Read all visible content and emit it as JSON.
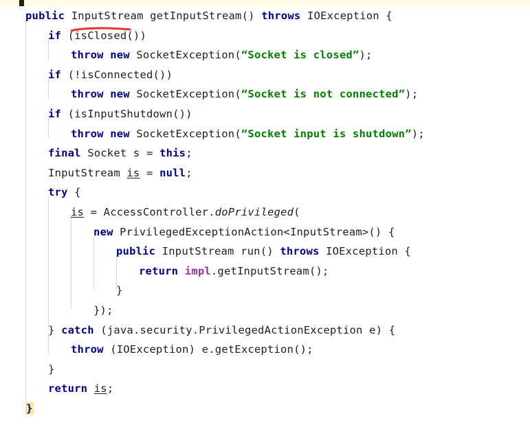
{
  "window": {
    "kind": "code-viewer",
    "background": "#ffffff",
    "top_band_color": "#fffbe6"
  },
  "theme": {
    "keyword": "#00008f",
    "string": "#008000",
    "field": "#9b30a0",
    "plain": "#202020",
    "guide": "#d6d6d6",
    "annotation": "#e8352b",
    "brace_highlight": "#ffe79a"
  },
  "annotation": {
    "type": "underline",
    "color": "#e8352b",
    "target_text": "InputStream"
  },
  "code": {
    "language": "Java",
    "lines": [
      {
        "indent": 1,
        "tokens": [
          {
            "t": "public",
            "c": "kw"
          },
          {
            "t": " ",
            "c": "plain"
          },
          {
            "t": "InputStream",
            "c": "plain"
          },
          {
            "t": " getInputStream() ",
            "c": "plain"
          },
          {
            "t": "throws",
            "c": "kw"
          },
          {
            "t": " IOException {",
            "c": "plain"
          }
        ]
      },
      {
        "indent": 2,
        "tokens": [
          {
            "t": "if",
            "c": "kw"
          },
          {
            "t": " (isClosed())",
            "c": "plain"
          }
        ]
      },
      {
        "indent": 3,
        "tokens": [
          {
            "t": "throw",
            "c": "kw"
          },
          {
            "t": " ",
            "c": "plain"
          },
          {
            "t": "new",
            "c": "kw"
          },
          {
            "t": " SocketException(",
            "c": "plain"
          },
          {
            "t": "“Socket is closed”",
            "c": "str"
          },
          {
            "t": ");",
            "c": "plain"
          }
        ]
      },
      {
        "indent": 2,
        "tokens": [
          {
            "t": "if",
            "c": "kw"
          },
          {
            "t": " (!isConnected())",
            "c": "plain"
          }
        ]
      },
      {
        "indent": 3,
        "tokens": [
          {
            "t": "throw",
            "c": "kw"
          },
          {
            "t": " ",
            "c": "plain"
          },
          {
            "t": "new",
            "c": "kw"
          },
          {
            "t": " SocketException(",
            "c": "plain"
          },
          {
            "t": "“Socket is not connected”",
            "c": "str"
          },
          {
            "t": ");",
            "c": "plain"
          }
        ]
      },
      {
        "indent": 2,
        "tokens": [
          {
            "t": "if",
            "c": "kw"
          },
          {
            "t": " (isInputShutdown())",
            "c": "plain"
          }
        ]
      },
      {
        "indent": 3,
        "tokens": [
          {
            "t": "throw",
            "c": "kw"
          },
          {
            "t": " ",
            "c": "plain"
          },
          {
            "t": "new",
            "c": "kw"
          },
          {
            "t": " SocketException(",
            "c": "plain"
          },
          {
            "t": "“Socket input is shutdown”",
            "c": "str"
          },
          {
            "t": ");",
            "c": "plain"
          }
        ]
      },
      {
        "indent": 2,
        "tokens": [
          {
            "t": "final",
            "c": "kw"
          },
          {
            "t": " Socket s = ",
            "c": "plain"
          },
          {
            "t": "this",
            "c": "kw"
          },
          {
            "t": ";",
            "c": "plain"
          }
        ]
      },
      {
        "indent": 2,
        "tokens": [
          {
            "t": "InputStream ",
            "c": "plain"
          },
          {
            "t": "is",
            "c": "local"
          },
          {
            "t": " = ",
            "c": "plain"
          },
          {
            "t": "null",
            "c": "kw"
          },
          {
            "t": ";",
            "c": "plain"
          }
        ]
      },
      {
        "indent": 2,
        "tokens": [
          {
            "t": "try",
            "c": "kw"
          },
          {
            "t": " {",
            "c": "plain"
          }
        ]
      },
      {
        "indent": 3,
        "tokens": [
          {
            "t": "is",
            "c": "local"
          },
          {
            "t": " = AccessController.",
            "c": "plain"
          },
          {
            "t": "doPrivileged",
            "c": "ital"
          },
          {
            "t": "(",
            "c": "plain"
          }
        ]
      },
      {
        "indent": 4,
        "tokens": [
          {
            "t": "new",
            "c": "kw"
          },
          {
            "t": " PrivilegedExceptionAction<InputStream>() {",
            "c": "plain"
          }
        ]
      },
      {
        "indent": 5,
        "tokens": [
          {
            "t": "public",
            "c": "kw"
          },
          {
            "t": " InputStream run() ",
            "c": "plain"
          },
          {
            "t": "throws",
            "c": "kw"
          },
          {
            "t": " IOException {",
            "c": "plain"
          }
        ]
      },
      {
        "indent": 6,
        "tokens": [
          {
            "t": "return",
            "c": "kw"
          },
          {
            "t": " ",
            "c": "plain"
          },
          {
            "t": "impl",
            "c": "field"
          },
          {
            "t": ".getInputStream();",
            "c": "plain"
          }
        ]
      },
      {
        "indent": 5,
        "tokens": [
          {
            "t": "}",
            "c": "plain"
          }
        ]
      },
      {
        "indent": 4,
        "tokens": [
          {
            "t": "});",
            "c": "plain"
          }
        ]
      },
      {
        "indent": 2,
        "tokens": [
          {
            "t": "} ",
            "c": "plain"
          },
          {
            "t": "catch",
            "c": "kw"
          },
          {
            "t": " (java.security.PrivilegedActionException e) {",
            "c": "plain"
          }
        ]
      },
      {
        "indent": 3,
        "tokens": [
          {
            "t": "throw",
            "c": "kw"
          },
          {
            "t": " (IOException) e.getException();",
            "c": "plain"
          }
        ]
      },
      {
        "indent": 2,
        "tokens": [
          {
            "t": "}",
            "c": "plain"
          }
        ]
      },
      {
        "indent": 2,
        "tokens": [
          {
            "t": "return",
            "c": "kw"
          },
          {
            "t": " ",
            "c": "plain"
          },
          {
            "t": "is",
            "c": "local"
          },
          {
            "t": ";",
            "c": "plain"
          }
        ]
      },
      {
        "indent": 1,
        "tokens": [
          {
            "t": "}",
            "c": "bracehl"
          }
        ]
      }
    ]
  }
}
